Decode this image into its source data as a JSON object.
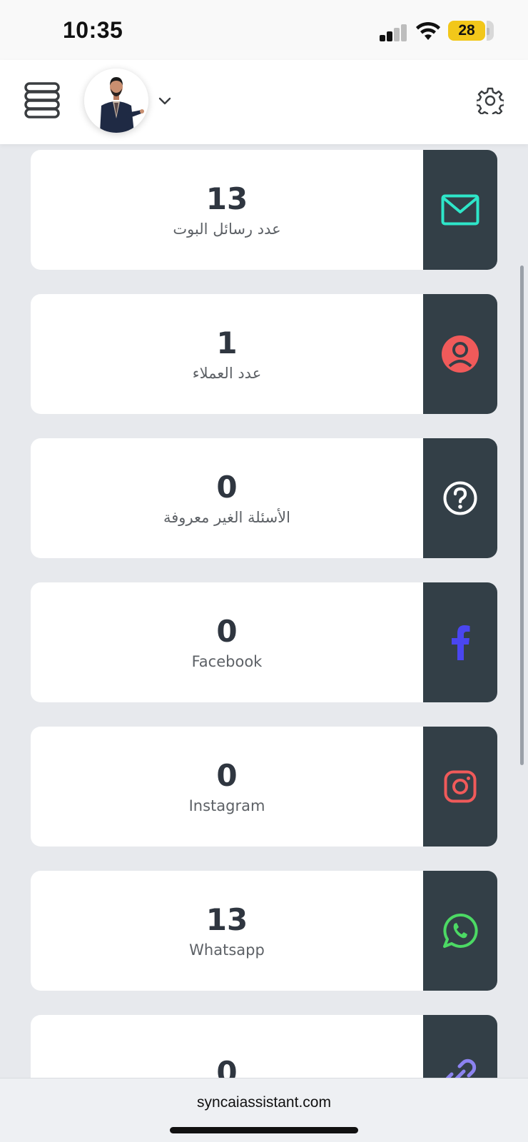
{
  "status_bar": {
    "time": "10:35",
    "battery": "28"
  },
  "header": {
    "menu_icon": "stack-menu-icon",
    "avatar_icon": "user-avatar",
    "dropdown_icon": "chevron-down-icon",
    "settings_icon": "gear-icon"
  },
  "cards": [
    {
      "value": "13",
      "label": "عدد رسائل البوت",
      "icon": "envelope-icon",
      "icon_color": "#2ee6c9"
    },
    {
      "value": "1",
      "label": "عدد العملاء",
      "icon": "user-circle-icon",
      "icon_color": "#f05a5a"
    },
    {
      "value": "0",
      "label": "الأسئلة الغير معروفة",
      "icon": "question-circle-icon",
      "icon_color": "#ffffff"
    },
    {
      "value": "0",
      "label": "Facebook",
      "icon": "facebook-icon",
      "icon_color": "#4a46f0"
    },
    {
      "value": "0",
      "label": "Instagram",
      "icon": "instagram-icon",
      "icon_color": "#f05a5a"
    },
    {
      "value": "13",
      "label": "Whatsapp",
      "icon": "whatsapp-icon",
      "icon_color": "#4cd964"
    },
    {
      "value": "0",
      "label": "",
      "icon": "link-icon",
      "icon_color": "#8c83f0"
    }
  ],
  "url_bar": {
    "url": "syncaiassistant.com"
  }
}
